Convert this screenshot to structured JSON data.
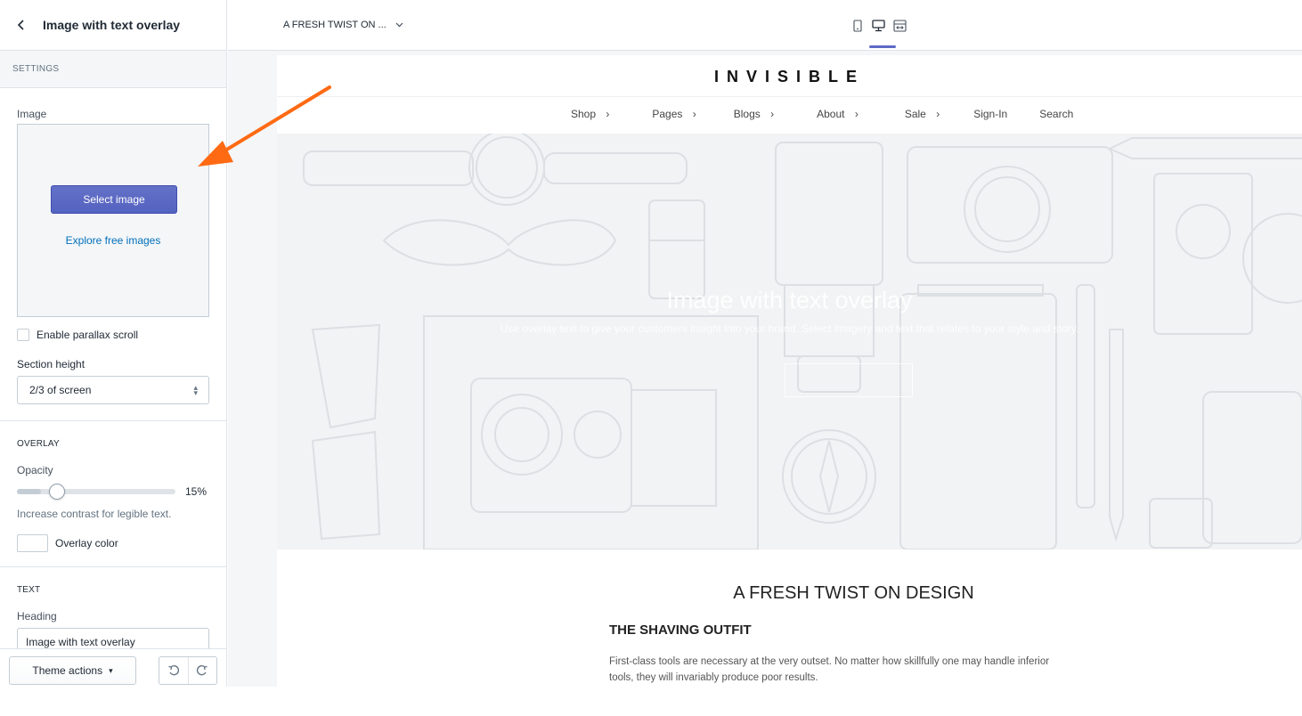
{
  "sidebar": {
    "title": "Image with text overlay",
    "settings_label": "SETTINGS",
    "image_label": "Image",
    "select_image_label": "Select image",
    "explore_link": "Explore free images",
    "parallax_label": "Enable parallax scroll",
    "section_height_label_bold": "Section",
    "section_height_label_rest": " height",
    "section_height_value": "2/3 of screen",
    "overlay_heading": "OVERLAY",
    "opacity_label": "Opacity",
    "opacity_value": "15%",
    "opacity_fraction": 0.15,
    "opacity_help": "Increase contrast for legible text.",
    "overlay_color_label": "Overlay color",
    "overlay_color": "#ffffff",
    "text_heading": "TEXT",
    "heading_label": "Heading",
    "heading_value": "Image with text overlay",
    "theme_actions_label": "Theme actions",
    "theme_actions_caret": "▾"
  },
  "topbar": {
    "page_select": "A FRESH TWIST ON ...",
    "view_modes": [
      "mobile-icon",
      "desktop-icon",
      "fullwidth-icon"
    ],
    "active_view": "desktop-icon"
  },
  "preview": {
    "logo": "INVISIBLE",
    "nav": [
      {
        "label": "Shop",
        "has_submenu": true
      },
      {
        "label": "Pages",
        "has_submenu": true
      },
      {
        "label": "Blogs",
        "has_submenu": true
      },
      {
        "label": "About",
        "has_submenu": true
      },
      {
        "label": "Sale",
        "has_submenu": true
      },
      {
        "label": "Sign-In",
        "has_submenu": false
      },
      {
        "label": "Search",
        "has_submenu": false
      }
    ],
    "hero_heading": "Image with text overlay",
    "hero_subheading": "Use overlay text to give your customers insight into your brand. Select imagery and text that relates to your style and story.",
    "content_title": "A FRESH TWIST ON DESIGN",
    "content_subtitle": "THE SHAVING OUTFIT",
    "content_body": "First-class tools are necessary at the very outset. No matter how skillfully one may handle inferior tools, they will invariably produce poor results."
  },
  "colors": {
    "accent": "#5c6ac4",
    "link": "#006fbb",
    "annotation_arrow": "#ff6a13",
    "border": "#dfe3e8"
  }
}
